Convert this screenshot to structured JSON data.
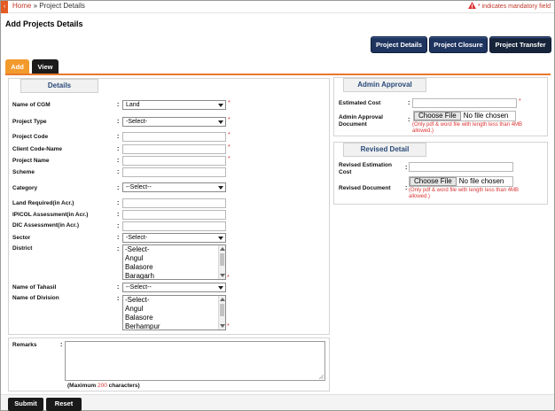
{
  "breadcrumb": {
    "home": "Home",
    "sep": "»",
    "current": "Project Details"
  },
  "mandatory_note": "indicates mandatory field",
  "page_title": "Add Projects Details",
  "top_buttons": [
    "Project Details",
    "Project Closure",
    "Project Transfer"
  ],
  "tabs": {
    "add": "Add",
    "view": "View"
  },
  "details": {
    "legend": "Details",
    "cgm": {
      "label": "Name of CGM",
      "value": "Land"
    },
    "project_type": {
      "label": "Project Type",
      "value": "-Select-"
    },
    "project_code": {
      "label": "Project Code"
    },
    "client_code": {
      "label": "Client Code-Name"
    },
    "project_name": {
      "label": "Project Name"
    },
    "scheme": {
      "label": "Scheme"
    },
    "category": {
      "label": "Category",
      "value": "--Select--"
    },
    "land_required": {
      "label": "Land Required(in Acr.)"
    },
    "ipicol": {
      "label": "IPICOL Assessment(in Acr.)"
    },
    "dic": {
      "label": "DIC Assessment(in Acr.)"
    },
    "sector": {
      "label": "Sector",
      "value": "-Select-"
    },
    "district": {
      "label": "District",
      "options": [
        "-Select-",
        "Angul",
        "Balasore",
        "Baragarh"
      ]
    },
    "tahasil": {
      "label": "Name of Tahasil",
      "value": "--Select--"
    },
    "division": {
      "label": "Name of Division",
      "options": [
        "-Select-",
        "Angul",
        "Balasore",
        "Berhampur"
      ]
    }
  },
  "admin": {
    "legend": "Admin Approval",
    "estimated_cost": "Estimated Cost",
    "approval_doc": "Admin Approval Document",
    "file_button": "Choose File",
    "file_text": "No file chosen",
    "hint": "(Only pdf & word file with length less than 4MB allowed.)"
  },
  "revised": {
    "legend": "Revised Detail",
    "estimation_cost": "Revised Estimation Cost",
    "document": "Revised Document",
    "file_button": "Choose File",
    "file_text": "No file chosen",
    "hint": "(Only pdf & word file with length less than 4MB allowed.)"
  },
  "remarks": {
    "label": "Remarks",
    "max_prefix": "(Maximum",
    "max_num": "200",
    "max_suffix": "characters)"
  },
  "footer": {
    "submit": "Submit",
    "reset": "Reset"
  },
  "colors": {
    "accent": "#e8782b",
    "navy": "#1f3560",
    "required": "#dd3333"
  }
}
